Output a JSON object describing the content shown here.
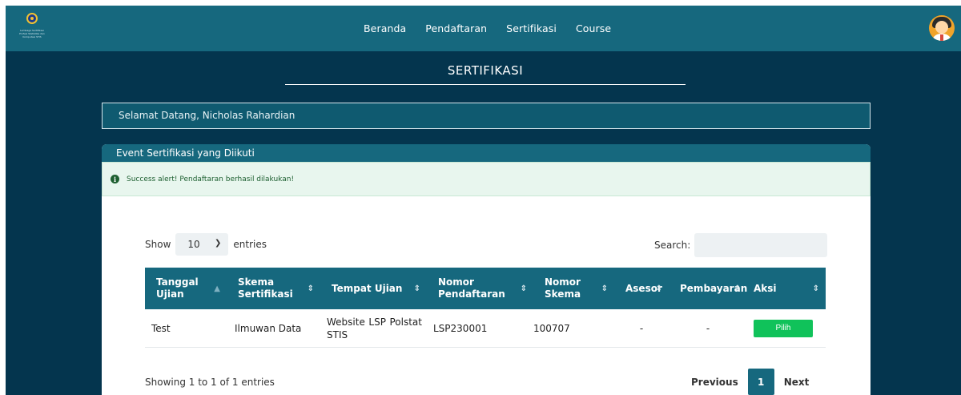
{
  "colors": {
    "page_bg": "#04354e",
    "nav_bg": "#16687e",
    "accent": "#16687e",
    "success_button": "#10c25a",
    "alert_bg": "#e8f6ee",
    "alert_text": "#1d5f30"
  },
  "navbar": {
    "logo_text": "Lembaga Sertifikasi Profesi Statistika dan Komputasi STIS",
    "links": [
      "Beranda",
      "Pendaftaran",
      "Sertifikasi",
      "Course"
    ],
    "avatar_icon": "user-avatar-icon"
  },
  "page": {
    "title": "SERTIFIKASI"
  },
  "welcome": {
    "text": "Selamat Datang, Nicholas Rahardian"
  },
  "card": {
    "header": "Event Sertifikasi yang Diikuti",
    "alert": {
      "icon": "info-circle-icon",
      "text": "Success alert! Pendaftaran berhasil dilakukan!"
    }
  },
  "table_controls": {
    "show_label": "Show",
    "length_value": "10",
    "entries_label": "entries",
    "search_label": "Search:",
    "search_value": ""
  },
  "table": {
    "columns": [
      "Tanggal Ujian",
      "Skema Sertifikasi",
      "Tempat Ujian",
      "Nomor Pendaftaran",
      "Nomor Skema",
      "Asesor",
      "Pembayaran",
      "Aksi"
    ],
    "rows": [
      {
        "tanggal": "Test",
        "skema": "Ilmuwan Data",
        "tempat": "Website LSP Polstat STIS",
        "nomor_pendaftaran": "LSP230001",
        "nomor_skema": "100707",
        "asesor": "-",
        "pembayaran": "-",
        "aksi": "Pilih"
      }
    ]
  },
  "pagination": {
    "info": "Showing 1 to 1 of 1 entries",
    "previous": "Previous",
    "current": "1",
    "next": "Next"
  }
}
